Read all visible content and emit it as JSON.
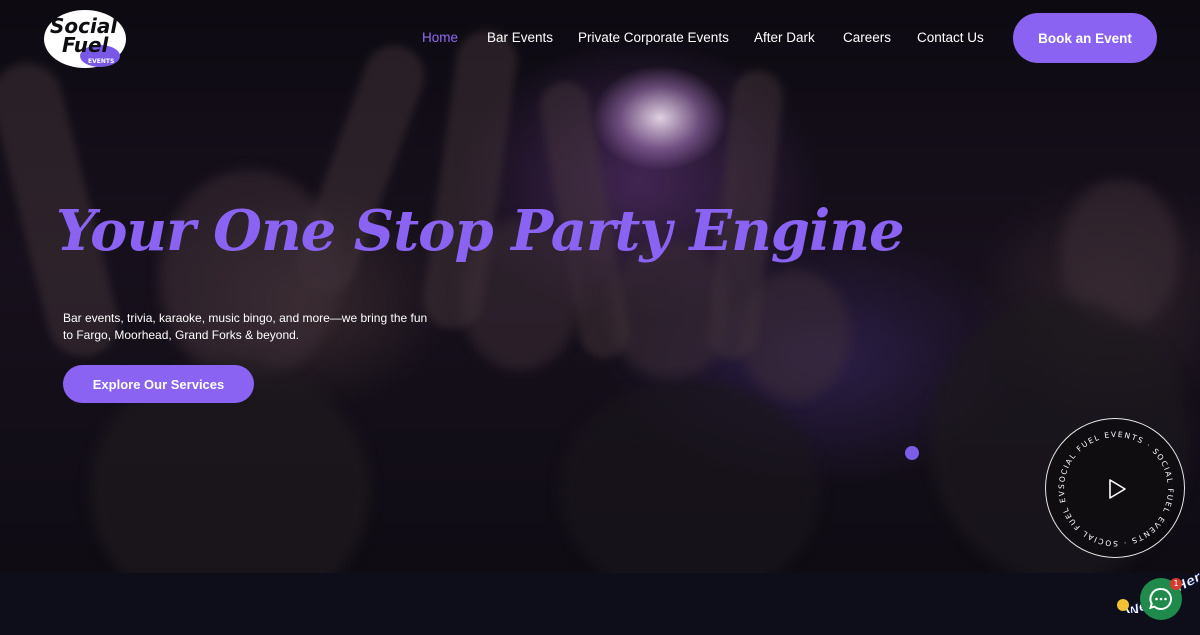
{
  "brand": {
    "logo_line1": "Social",
    "logo_line2": "Fuel",
    "logo_line3": "EVENTS"
  },
  "nav": {
    "items": [
      {
        "label": "Home",
        "active": true
      },
      {
        "label": "Bar Events",
        "active": false
      },
      {
        "label": "Private Corporate Events",
        "active": false
      },
      {
        "label": "After Dark",
        "active": false
      },
      {
        "label": "Careers",
        "active": false
      },
      {
        "label": "Contact Us",
        "active": false
      }
    ],
    "cta_label": "Book an Event"
  },
  "hero": {
    "headline": "Your One Stop Party Engine",
    "subcopy": "Bar events, trivia, karaoke, music bingo, and more—we bring the fun to Fargo, Moorhead, Grand Forks & beyond.",
    "cta_label": "Explore Our Services"
  },
  "video_badge": {
    "ring_text": "SOCIAL FUEL EVENTS · SOCIAL FUEL EVENTS · SOCIAL FUEL EVENTS · ",
    "icon": "play-icon"
  },
  "chat": {
    "label": "We Are Here!",
    "unread_count": "1",
    "icon": "chat-bubble-icon"
  },
  "colors": {
    "accent": "#8a63f2",
    "chat_green": "#1f8a4c",
    "badge_red": "#d63b2f"
  }
}
